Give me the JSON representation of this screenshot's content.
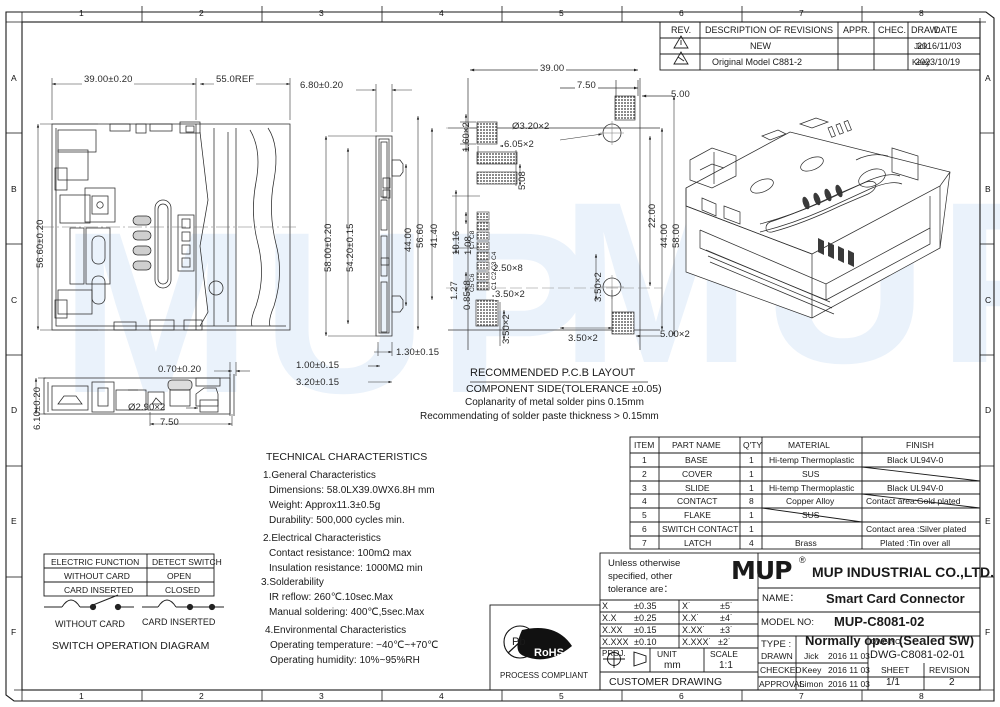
{
  "sheet": {
    "zones_top": [
      "1",
      "2",
      "3",
      "4",
      "5",
      "6",
      "7",
      "8"
    ],
    "zones_bottom": [
      "1",
      "2",
      "3",
      "4",
      "5",
      "6",
      "7",
      "8"
    ],
    "zones_left": [
      "A",
      "B",
      "C",
      "D",
      "E",
      "F"
    ],
    "zones_right": [
      "A",
      "B",
      "C",
      "D",
      "E",
      "F"
    ],
    "watermark": "MUP"
  },
  "revision_table": {
    "headers": [
      "REV.",
      "DESCRIPTION OF REVISIONS",
      "APPR.",
      "CHEC.",
      "DRAW.",
      "DATE"
    ],
    "rows": [
      {
        "rev": "1",
        "description": "NEW",
        "appr": "",
        "chec": "",
        "draw": "Jick",
        "date": "2016/11/03"
      },
      {
        "rev": "2",
        "description": "Original Model  C881-2",
        "appr": "",
        "chec": "",
        "draw": "Keey",
        "date": "2023/10/19"
      }
    ]
  },
  "views": {
    "front": {
      "dims": [
        "39.00±0.20",
        "55.0REF",
        "56.60±0.20"
      ]
    },
    "side": {
      "dims": [
        "6.80±0.20",
        "58.00±0.20",
        "54.20±0.15",
        "44.00",
        "1.30±0.15",
        "1.00±0.15",
        "3.20±0.15"
      ]
    },
    "bottom": {
      "dims": [
        "0.70±0.20",
        "6.10±0.20",
        "Ø2.90×2",
        "7.50"
      ]
    },
    "pcb": {
      "title": "RECOMMENDED  P.C.B  LAYOUT",
      "subtitle": "COMPONENT SIDE(TOLERANCE  ±0.05)",
      "note1": "Coplanarity of  metal  solder pins  0.15mm",
      "note2": "Recommendating of   solder  paste  thickness > 0.15mm",
      "dims": [
        "39.00",
        "7.50",
        "5.00",
        "Ø3.20×2",
        "22.00",
        "44.00",
        "58.00",
        "56.60",
        "41.40",
        "1.60×2",
        "6.05×2",
        "5.08",
        "10.16",
        "1.08",
        "1.27",
        "0.85×8",
        "2.50×8",
        "3.50×2",
        "3.50×2",
        "3.50×2",
        "3.50×2",
        "5.00×2"
      ],
      "pad_labels": [
        "C1",
        "C2",
        "C3",
        "C4",
        "C5",
        "C6",
        "C7",
        "C8"
      ]
    }
  },
  "technical": {
    "title": "TECHNICAL  CHARACTERISTICS",
    "sections": [
      {
        "heading": "1.General  Characteristics",
        "lines": [
          "Dimensions: 58.0LX39.0WX6.8H  mm",
          "Weight: Approx11.3±0.5g",
          "Durability: 500,000  cycles  min."
        ]
      },
      {
        "heading": "2.Electrical  Characteristics",
        "lines": [
          "Contact  resistance: 100mΩ max",
          "Insulation  resistance: 1000MΩ min"
        ]
      },
      {
        "heading": "3.Solderability",
        "lines": [
          "IR  reflow: 260℃.10sec.Max",
          "Manual  soldering: 400℃,5sec.Max"
        ]
      },
      {
        "heading": "4.Environmental  Characteristics",
        "lines": [
          "Operating  temperature: −40℃~+70℃",
          "Operating  humidity: 10%~95%RH"
        ]
      }
    ]
  },
  "switch_diagram": {
    "table": {
      "headers": [
        "ELECTRIC FUNCTION",
        "DETECT SWITCH"
      ],
      "rows": [
        [
          "WITHOUT CARD",
          "OPEN"
        ],
        [
          "CARD INSERTED",
          "CLOSED"
        ]
      ]
    },
    "label_left": "WITHOUT CARD",
    "label_right": "CARD INSERTED",
    "caption": "SWITCH  OPERATION  DIAGRAM"
  },
  "parts_table": {
    "headers": [
      "ITEM",
      "PART NAME",
      "Q'TY",
      "MATERIAL",
      "FINISH"
    ],
    "rows": [
      {
        "item": "1",
        "name": "BASE",
        "qty": "1",
        "material": "Hi-temp  Thermoplastic",
        "finish": "Black  UL94V-0"
      },
      {
        "item": "2",
        "name": "COVER",
        "qty": "1",
        "material": "SUS",
        "finish": ""
      },
      {
        "item": "3",
        "name": "SLIDE",
        "qty": "1",
        "material": "Hi-temp  Thermoplastic",
        "finish": "Black  UL94V-0"
      },
      {
        "item": "4",
        "name": "CONTACT",
        "qty": "8",
        "material": "Copper  Alloy",
        "finish": "Contact area:Gold  plated"
      },
      {
        "item": "5",
        "name": "FLAKE",
        "qty": "1",
        "material": "SUS",
        "finish": ""
      },
      {
        "item": "6",
        "name": "SWITCH CONTACT",
        "qty": "1",
        "material": "",
        "finish": "Contact area :Silver plated"
      },
      {
        "item": "7",
        "name": "LATCH",
        "qty": "4",
        "material": "Brass",
        "finish": "Plated :Tin  over  all"
      }
    ]
  },
  "title_block": {
    "tolerance_note": [
      "Unless  otherwise",
      "specified,  other",
      "tolerance  are："
    ],
    "tolerances": [
      [
        "X",
        "±0.35",
        "X˙",
        "±5˙"
      ],
      [
        "X.X",
        "±0.25",
        "X.X˙",
        "±4˙"
      ],
      [
        "X.XX",
        "±0.15",
        "X.XX˙",
        "±3˙"
      ],
      [
        "X.XXX",
        "±0.10",
        "X.XXX˙",
        "±2˙"
      ]
    ],
    "proj_label": "PROJ.",
    "unit_label": "UNIT",
    "unit_value": "mm",
    "scale_label": "SCALE",
    "scale_value": "1:1",
    "customer_drawing": "CUSTOMER   DRAWING",
    "company": "MUP INDUSTRIAL CO.,LTD.",
    "logo": "MUP",
    "logo_mark": "®",
    "name_label": "NAME：",
    "name_value": "Smart Card Connector",
    "model_label": "MODEL  NO:",
    "model_value": "MUP-C8081-02",
    "type_label": "TYPE :",
    "type_value": "Normally open (Sealed SW)",
    "drawn_label": "DRAWN",
    "drawn_by": "Jick",
    "drawn_date": "2016  11  03",
    "checked_label": "CHECKED",
    "checked_by": "Keey",
    "checked_date": "2016  11  03",
    "approval_label": "APPROVAL",
    "approval_by": "Simon",
    "approval_date": "2016  11  03",
    "dwg_label": "DWG NO. :",
    "dwg_value": "DWG-C8081-02-01",
    "sheet_label": "SHEET",
    "sheet_value": "1/1",
    "revision_label": "REVISION",
    "revision_value": "2"
  },
  "rohs": {
    "mark": "Pb",
    "text": "RoHS",
    "caption": "PROCESS COMPLIANT"
  },
  "colors": {
    "line": "#1a1a1a",
    "thin": "#555555",
    "watermark": "#eaf2fb",
    "hatch": "#333333"
  }
}
